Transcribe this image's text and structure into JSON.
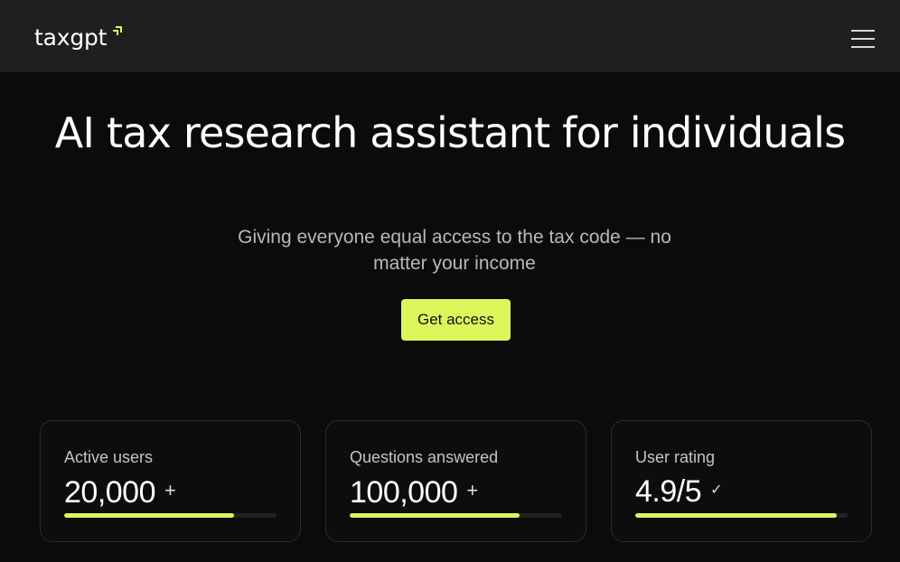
{
  "brand": {
    "name": "taxgpt",
    "accent": "#dcf75b"
  },
  "nav": {
    "menu_icon": "hamburger-menu-icon"
  },
  "hero": {
    "title": "AI tax research assistant for individuals",
    "subtitle": "Giving everyone equal access to the tax code — no matter your income",
    "cta_label": "Get access"
  },
  "stats": [
    {
      "label": "Active users",
      "value": "20,000",
      "suffix": "+",
      "progress": 0.8
    },
    {
      "label": "Questions answered",
      "value": "100,000",
      "suffix": "+",
      "progress": 0.8
    },
    {
      "label": "User rating",
      "value": "4.9/5",
      "suffix": "✓",
      "progress": 0.95
    }
  ]
}
